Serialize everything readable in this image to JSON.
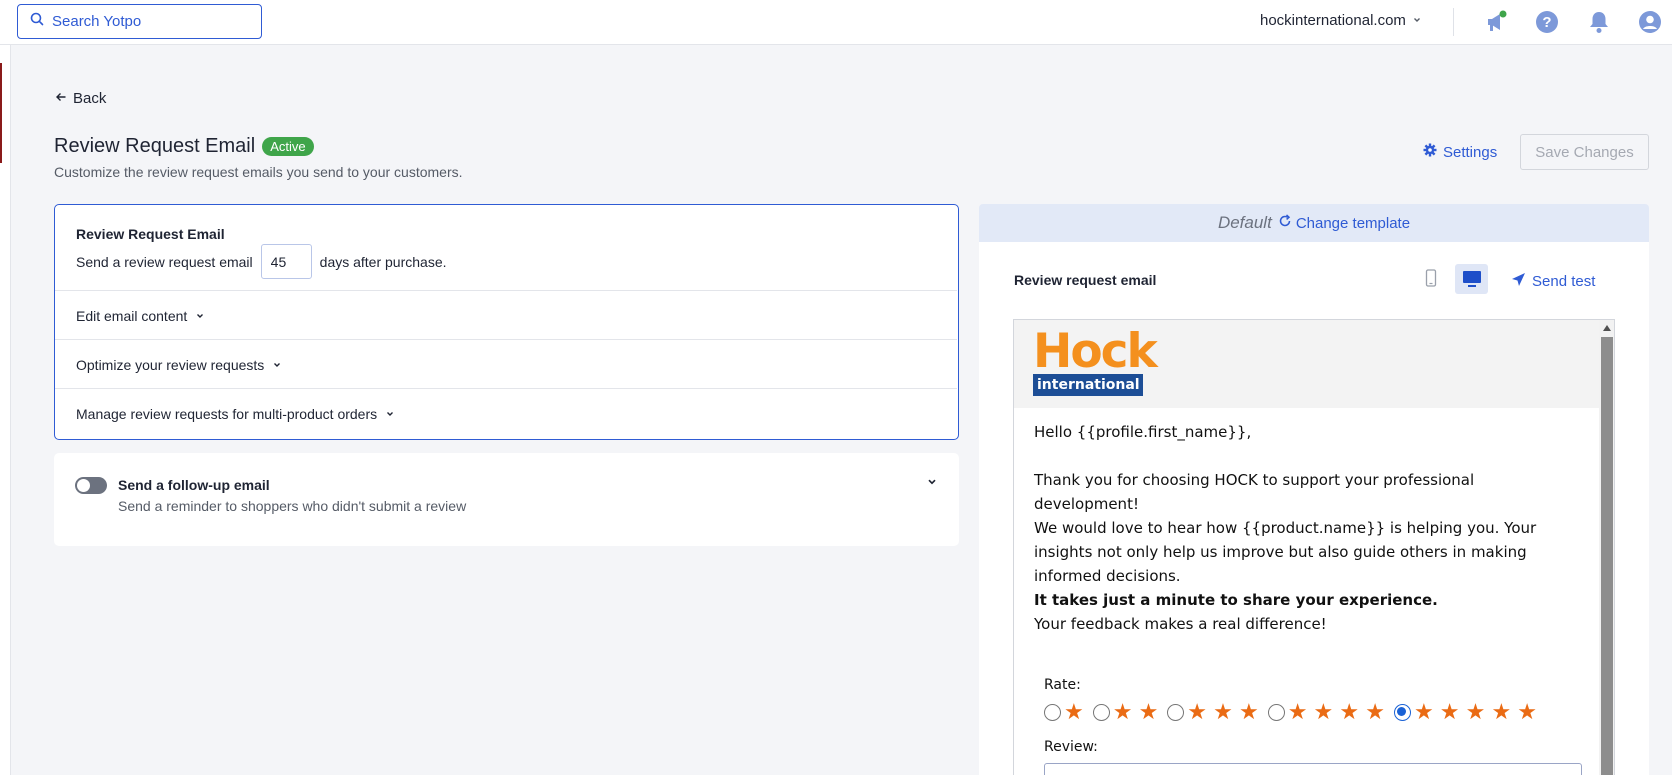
{
  "topbar": {
    "search_placeholder": "Search Yotpo",
    "store_name": "hockinternational.com",
    "icons": [
      "search-icon",
      "chevron-down-icon",
      "announcement-icon",
      "help-icon",
      "bell-icon",
      "user-icon"
    ]
  },
  "page": {
    "back_label": "Back",
    "title": "Review Request Email",
    "status_badge": "Active",
    "subtitle": "Customize the review request emails you send to your customers.",
    "settings_label": "Settings",
    "save_label": "Save Changes"
  },
  "review_card": {
    "title": "Review Request Email",
    "send_prefix": "Send a review request email",
    "days_value": "45",
    "send_suffix": "days after purchase.",
    "accordions": [
      {
        "label": "Edit email content"
      },
      {
        "label": "Optimize your review requests"
      },
      {
        "label": "Manage review requests for multi-product orders"
      }
    ]
  },
  "followup": {
    "title": "Send a follow-up email",
    "description": "Send a reminder to shoppers who didn't submit a review",
    "enabled": false
  },
  "preview": {
    "template_name": "Default",
    "change_template_label": "Change template",
    "label": "Review request email",
    "send_test_label": "Send test",
    "view_mode": "desktop",
    "logo_main": "Hock",
    "logo_sub": "international",
    "email": {
      "greeting": "Hello {{profile.first_name}},",
      "para1": "Thank you for choosing HOCK to support your professional development!",
      "para2": "We would love to hear how {{product.name}} is helping you. Your insights not only help us improve but also guide others in making informed decisions.",
      "bold_line": "It takes just a minute to share your experience.",
      "line2": "Your feedback makes a real difference!",
      "rate_label": "Rate:",
      "selected_rating": 5,
      "review_label": "Review:"
    }
  },
  "colors": {
    "accent": "#2f5bd4",
    "active_badge": "#3fa54a",
    "star": "#ea6b14",
    "logo_orange": "#f4901e",
    "logo_blue": "#1d4e96"
  }
}
